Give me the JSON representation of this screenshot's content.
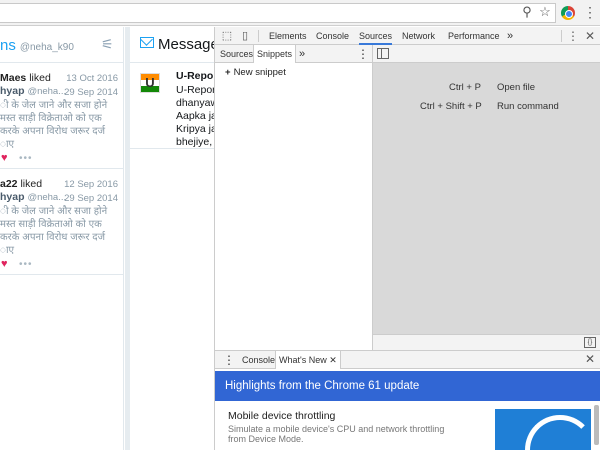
{
  "browser": {
    "icons": [
      "pin-icon",
      "star-icon",
      "chrome-extension-icon",
      "menu-icon"
    ]
  },
  "notifications": {
    "title_prefix": "ns",
    "handle": "@neha_k90",
    "items": [
      {
        "actor": "Maes",
        "action": "liked",
        "date": "13 Oct 2016",
        "author_name": "hyap",
        "author_handle": "@neha...",
        "tweet_date": "29 Sep 2014",
        "lines": [
          "ी के जेल जाने और सजा होने",
          "मस्त साड़ी विक्रेताओ को एक",
          "करके अपना विरोध जरूर दर्ज",
          "ाए"
        ]
      },
      {
        "actor": "a22",
        "action": "liked",
        "date": "12 Sep 2016",
        "author_name": "hyap",
        "author_handle": "@neha...",
        "tweet_date": "29 Sep 2014",
        "lines": [
          "ी के जेल जाने और सजा होने",
          "मस्त साड़ी विक्रेताओ को एक",
          "करके अपना विरोध जरूर दर्ज",
          "ाए"
        ]
      }
    ]
  },
  "messages": {
    "title": "Message",
    "item": {
      "name": "U-Report",
      "lines": [
        "U-Report",
        "dhanyaw",
        "Aapka ja",
        "Kripya ja",
        "bhejiye, j"
      ]
    }
  },
  "devtools": {
    "tabs": [
      "Elements",
      "Console",
      "Sources",
      "Network",
      "Performance"
    ],
    "active_tab": "Sources",
    "more_tabs": "»",
    "navigator_tabs": [
      "Sources",
      "Snippets"
    ],
    "navigator_active": "Snippets",
    "navigator_more": "»",
    "new_snippet": "New snippet",
    "shortcuts": [
      {
        "keys": "Ctrl + P",
        "action": "Open file"
      },
      {
        "keys": "Ctrl + Shift + P",
        "action": "Run command"
      }
    ],
    "drawer": {
      "tabs": [
        "Console",
        "What's New"
      ],
      "active": "What's New",
      "banner": "Highlights from the Chrome 61 update",
      "feature_title": "Mobile device throttling",
      "feature_desc": "Simulate a mobile device's CPU and network throttling from Device Mode."
    }
  }
}
